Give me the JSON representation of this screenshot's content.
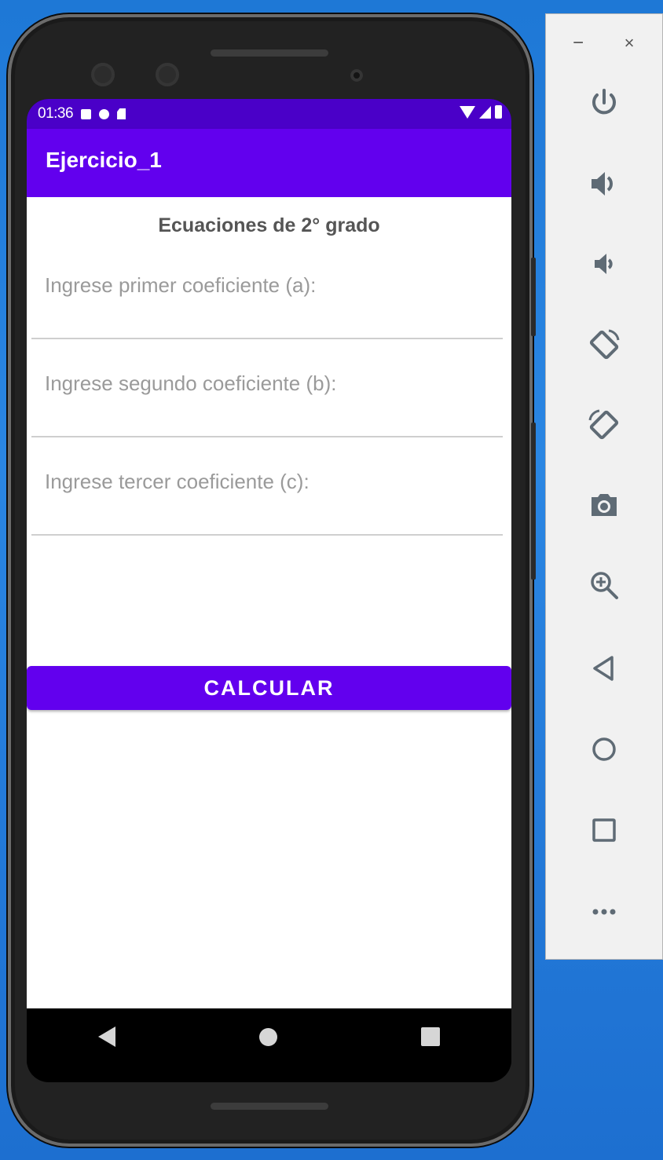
{
  "status_bar": {
    "time": "01:36"
  },
  "app_bar": {
    "title": "Ejercicio_1"
  },
  "main": {
    "heading": "Ecuaciones de 2° grado",
    "fields": [
      {
        "placeholder": "Ingrese primer coeficiente (a):",
        "value": ""
      },
      {
        "placeholder": "Ingrese segundo coeficiente (b):",
        "value": ""
      },
      {
        "placeholder": "Ingrese tercer coeficiente (c):",
        "value": ""
      }
    ],
    "button_label": "CALCULAR"
  },
  "navigation_bar": {
    "icons": [
      "back-icon",
      "home-icon",
      "recents-icon"
    ]
  },
  "emulator_toolbar": {
    "window_controls": {
      "minimize": "−",
      "close": "×"
    },
    "tools": [
      "power-icon",
      "volume-up-icon",
      "volume-down-icon",
      "rotate-left-icon",
      "rotate-right-icon",
      "camera-icon",
      "zoom-icon",
      "back-icon",
      "home-icon",
      "overview-icon",
      "more-icon"
    ]
  },
  "colors": {
    "primary": "#6200ee",
    "status_bar": "#4a00c8",
    "desktop": "#1e78d6"
  }
}
